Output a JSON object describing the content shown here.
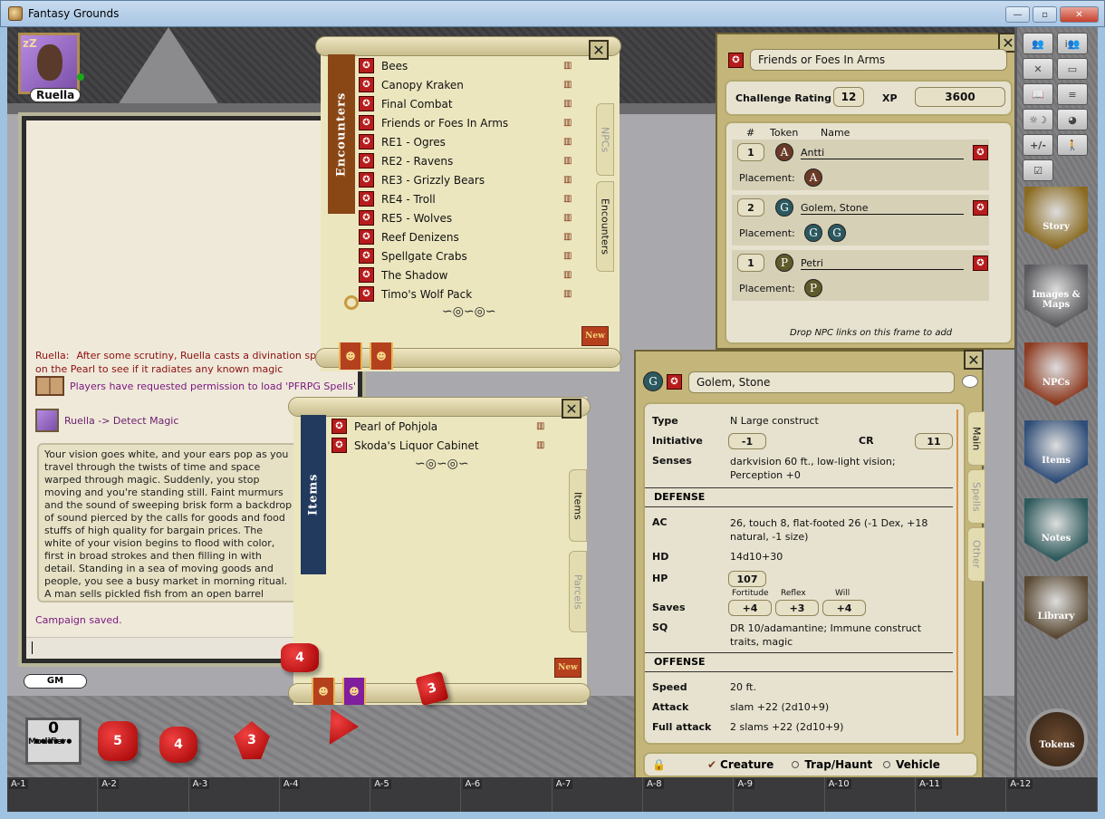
{
  "window": {
    "title": "Fantasy Grounds",
    "minimize_label": "—",
    "maximize_label": "▫",
    "close_label": "✕"
  },
  "player": {
    "name": "Ruella",
    "status_icon": "zzz",
    "online": true
  },
  "chat": {
    "messages": [
      {
        "speaker": "Ruella:",
        "text": "After some scrutiny, Ruella casts a divination spell on the Pearl to see if it radiates any known magic"
      },
      {
        "icon": "book-icon",
        "text": "Players have requested permission to load 'PFRPG Spells'"
      },
      {
        "icon": "portrait-icon",
        "text": "Ruella -> Detect Magic"
      }
    ],
    "story_text": "Your vision goes white, and your ears pop as you travel through the twists of time and space warped through magic. Suddenly, you stop moving and you're standing still. Faint murmurs and the sound of sweeping brisk form a backdrop of sound pierced by the calls for goods and food stuffs of high quality for bargain prices. The white of your vision begins to flood with color, first in broad strokes and then filling in with detail. Standing in a sea of moving goods and people, you see a busy market in morning ritual. A man sells pickled fish from an open barrel while another shows a fine bolt of cloth to a woman with raven hair draped in white.",
    "system_message": "Campaign saved.",
    "input_value": "",
    "identity": "GM"
  },
  "modifier": {
    "value": "0",
    "label": "Modifier",
    "dots": "●●●●●●"
  },
  "dice": [
    {
      "type": "d20",
      "face": "5"
    },
    {
      "type": "d12",
      "face": "4"
    },
    {
      "type": "d8",
      "face": "3"
    },
    {
      "type": "d4",
      "face": ""
    },
    {
      "type": "d10-rolled",
      "face": "4"
    },
    {
      "type": "d6-rolled",
      "face": "3"
    }
  ],
  "hotbar": [
    "A-1",
    "A-2",
    "A-3",
    "A-4",
    "A-5",
    "A-6",
    "A-7",
    "A-8",
    "A-9",
    "A-10",
    "A-11",
    "A-12"
  ],
  "encounters_window": {
    "side_label": "Encounters",
    "items": [
      "Bees",
      "Canopy Kraken",
      "Final Combat",
      "Friends or Foes In Arms",
      "RE1 - Ogres",
      "RE2 - Ravens",
      "RE3 - Grizzly Bears",
      "RE4 - Troll",
      "RE5 - Wolves",
      "Reef Denizens",
      "Spellgate Crabs",
      "The Shadow",
      "Timo's Wolf Pack"
    ],
    "tabs": [
      "NPCs",
      "Encounters"
    ],
    "new_label": "New",
    "close_label": "✕"
  },
  "items_window": {
    "side_label": "Items",
    "items": [
      "Pearl of Pohjola",
      "Skoda's Liquor Cabinet"
    ],
    "tabs": [
      "Items",
      "Parcels"
    ],
    "new_label": "New",
    "close_label": "✕"
  },
  "encounter_detail": {
    "name": "Friends or Foes In Arms",
    "cr_label": "Challenge Rating",
    "cr": "12",
    "xp_label": "XP",
    "xp": "3600",
    "col_count": "#",
    "col_token": "Token",
    "col_name": "Name",
    "placement_label": "Placement:",
    "npcs": [
      {
        "count": "1",
        "token": "A",
        "name": "Antti",
        "placements": [
          "A"
        ],
        "color": "#6b3a26"
      },
      {
        "count": "2",
        "token": "G",
        "name": "Golem, Stone",
        "placements": [
          "G",
          "G"
        ],
        "color": "#2c5960"
      },
      {
        "count": "1",
        "token": "P",
        "name": "Petri",
        "placements": [
          "P"
        ],
        "color": "#5e5a2a"
      }
    ],
    "drop_hint": "Drop NPC links on this frame to add",
    "close_label": "✕"
  },
  "npc_sheet": {
    "token": "G",
    "name": "Golem, Stone",
    "tabs": [
      "Main",
      "Spells",
      "Other"
    ],
    "type_label": "Type",
    "type": "N Large construct",
    "init_label": "Initiative",
    "init": "-1",
    "cr_label": "CR",
    "cr": "11",
    "senses_label": "Senses",
    "senses": "darkvision 60 ft., low-light vision; Perception +0",
    "defense_header": "DEFENSE",
    "ac_label": "AC",
    "ac": "26, touch 8, flat-footed 26 (-1 Dex, +18 natural, -1 size)",
    "hd_label": "HD",
    "hd": "14d10+30",
    "hp_label": "HP",
    "hp": "107",
    "saves_label": "Saves",
    "fort_label": "Fortitude",
    "fort": "+4",
    "ref_label": "Reflex",
    "ref": "+3",
    "will_label": "Will",
    "will": "+4",
    "sq_label": "SQ",
    "sq": "DR 10/adamantine; Immune construct traits, magic",
    "offense_header": "OFFENSE",
    "speed_label": "Speed",
    "speed": "20 ft.",
    "attack_label": "Attack",
    "attack": "slam +22 (2d10+9)",
    "full_attack_label": "Full attack",
    "full_attack": "2 slams +22 (2d10+9)",
    "mode_options": [
      {
        "label": "Creature",
        "selected": true
      },
      {
        "label": "Trap/Haunt",
        "selected": false
      },
      {
        "label": "Vehicle",
        "selected": false
      }
    ],
    "close_label": "✕"
  },
  "toolbar": {
    "buttons": [
      "party-icon",
      "info-party-icon",
      "combat-icon",
      "calendar-icon",
      "book-icon",
      "list-icon",
      "daynight-icon",
      "palette-icon",
      "modifier-icon",
      "character-icon",
      "checkbox-icon"
    ],
    "modifier_text": "+/-"
  },
  "sidebar": {
    "items": [
      {
        "label": "Story",
        "color": "#8a6a1f"
      },
      {
        "label": "Images & Maps",
        "color": "#5a5a5e"
      },
      {
        "label": "NPCs",
        "color": "#8d3a20"
      },
      {
        "label": "Items",
        "color": "#2f4d78"
      },
      {
        "label": "Notes",
        "color": "#2e5a5c"
      },
      {
        "label": "Library",
        "color": "#5a4a34"
      }
    ],
    "tokens_label": "Tokens"
  }
}
